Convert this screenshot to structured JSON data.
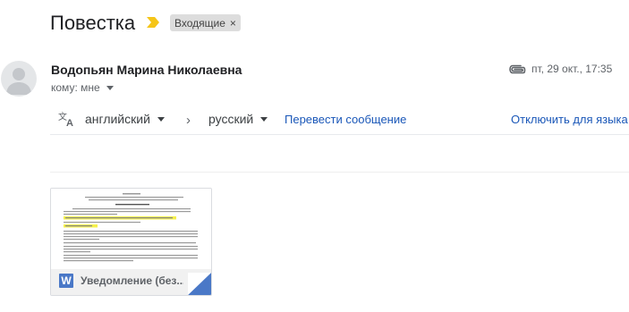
{
  "subject": "Повестка",
  "label_chip": {
    "text": "Входящие",
    "remove": "×"
  },
  "sender": {
    "name": "Водопьян Марина Николаевна"
  },
  "recipient": {
    "text": "кому: мне"
  },
  "date": "пт, 29 окт., 17:35",
  "translate": {
    "from_lang": "английский",
    "to_lang": "русский",
    "translate_link": "Перевести сообщение",
    "disable_link": "Отключить для языка"
  },
  "attachment": {
    "name": "Уведомление (без...",
    "type_letter": "W"
  },
  "colors": {
    "link": "#1a57b8",
    "importance": "#f5c518",
    "doc_blue": "#4a78c7",
    "highlight": "#f5f04a"
  },
  "icons": [
    "importance-marker-icon",
    "avatar-person-icon",
    "paperclip-icon",
    "translate-icon",
    "chevron-right-icon",
    "word-doc-icon"
  ]
}
